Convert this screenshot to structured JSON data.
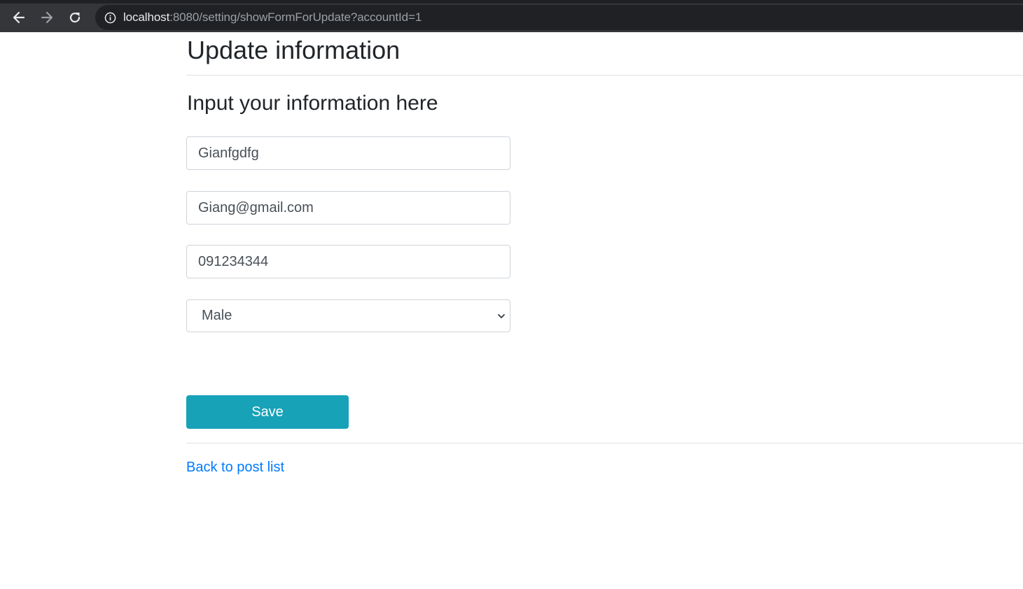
{
  "browser": {
    "url_host": "localhost",
    "url_rest": ":8080/setting/showFormForUpdate?accountId=1",
    "icons": {
      "back": "arrow-left",
      "forward": "arrow-right",
      "reload": "reload",
      "site_info": "info-circle"
    }
  },
  "page": {
    "title": "Update information",
    "section_title": "Input your information here"
  },
  "form": {
    "name_value": "Gianfgdfg",
    "email_value": "Giang@gmail.com",
    "phone_value": "091234344",
    "gender_selected": "Male",
    "save_label": "Save"
  },
  "links": {
    "back_label": "Back to post list"
  },
  "colors": {
    "primary_button": "#17a2b8",
    "link": "#007bff",
    "browser_bar": "#35363a",
    "omnibox": "#202124"
  }
}
